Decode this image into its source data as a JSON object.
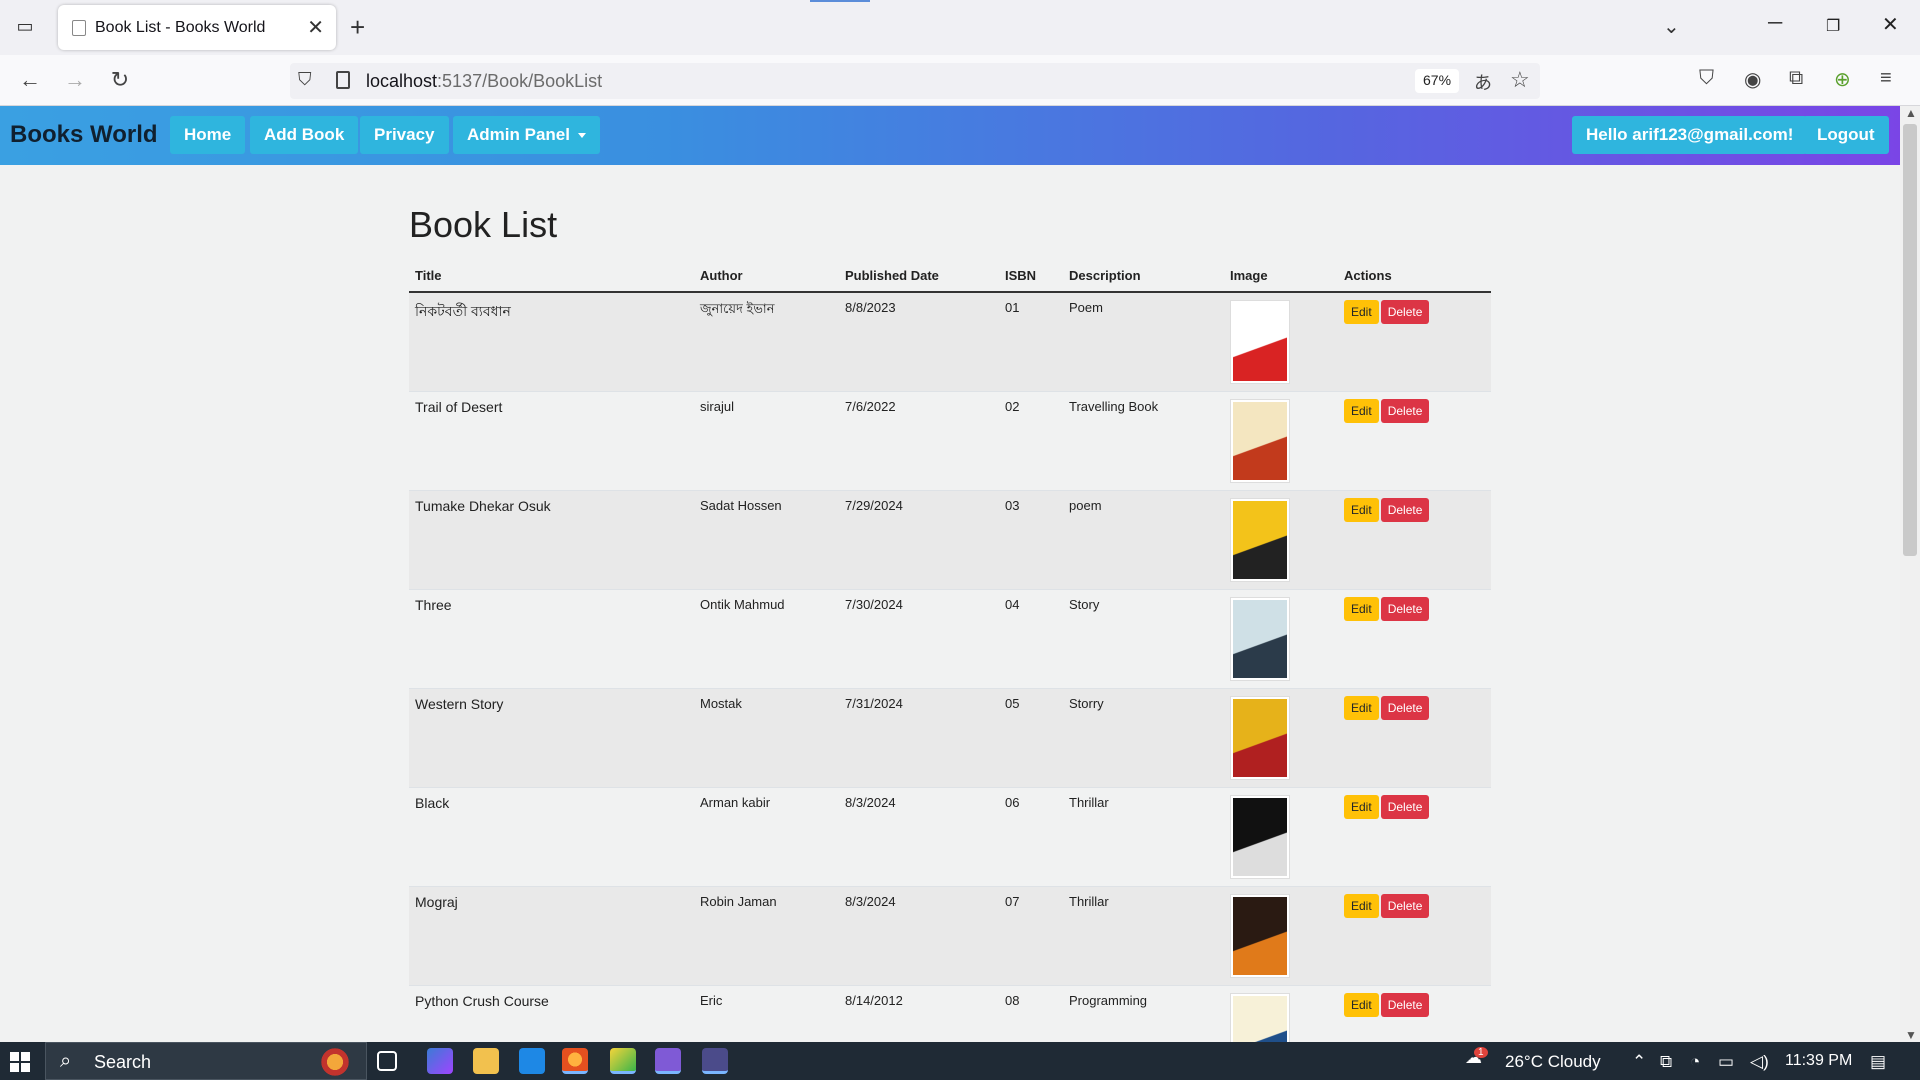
{
  "browser": {
    "tab_title": "Book List - Books World",
    "url_host": "localhost",
    "url_path": ":5137/Book/BookList",
    "zoom": "67%"
  },
  "site": {
    "brand": "Books World",
    "nav": {
      "home": "Home",
      "add_book": "Add Book",
      "privacy": "Privacy",
      "admin_panel": "Admin Panel"
    },
    "greeting": "Hello arif123@gmail.com!",
    "logout": "Logout"
  },
  "page_title": "Book List",
  "table": {
    "headers": [
      "Title",
      "Author",
      "Published Date",
      "ISBN",
      "Description",
      "Image",
      "Actions"
    ],
    "edit_label": "Edit",
    "delete_label": "Delete",
    "rows": [
      {
        "title": "নিকটবর্তী ব্যবধান",
        "author": "জুনায়েদ ইভান",
        "date": "8/8/2023",
        "isbn": "01",
        "description": "Poem",
        "cover_color": "#ffffff",
        "cover_accent": "#d92323"
      },
      {
        "title": "Trail of Desert",
        "author": "sirajul",
        "date": "7/6/2022",
        "isbn": "02",
        "description": "Travelling Book",
        "cover_color": "#f4e6c0",
        "cover_accent": "#c23a1c"
      },
      {
        "title": "Tumake Dhekar Osuk",
        "author": "Sadat Hossen",
        "date": "7/29/2024",
        "isbn": "03",
        "description": "poem",
        "cover_color": "#f3c31a",
        "cover_accent": "#222222"
      },
      {
        "title": "Three",
        "author": "Ontik Mahmud",
        "date": "7/30/2024",
        "isbn": "04",
        "description": "Story",
        "cover_color": "#cfe0e6",
        "cover_accent": "#2b3b4a"
      },
      {
        "title": "Western Story",
        "author": "Mostak",
        "date": "7/31/2024",
        "isbn": "05",
        "description": "Storry",
        "cover_color": "#e6b21a",
        "cover_accent": "#b02020"
      },
      {
        "title": "Black",
        "author": "Arman kabir",
        "date": "8/3/2024",
        "isbn": "06",
        "description": "Thrillar",
        "cover_color": "#111111",
        "cover_accent": "#dddddd"
      },
      {
        "title": "Mograj",
        "author": "Robin Jaman",
        "date": "8/3/2024",
        "isbn": "07",
        "description": "Thrillar",
        "cover_color": "#2a1a12",
        "cover_accent": "#e07a1a"
      },
      {
        "title": "Python Crush Course",
        "author": "Eric",
        "date": "8/14/2012",
        "isbn": "08",
        "description": "Programming",
        "cover_color": "#f7f1d8",
        "cover_accent": "#1f4f8a"
      }
    ]
  },
  "taskbar": {
    "search_label": "Search",
    "weather": "26°C  Cloudy",
    "time": "11:39 PM",
    "notification_badge": "1"
  },
  "icons": {
    "tab_list": "tab-list-icon",
    "back": "back-arrow-icon",
    "forward": "forward-arrow-icon",
    "reload": "reload-icon"
  }
}
